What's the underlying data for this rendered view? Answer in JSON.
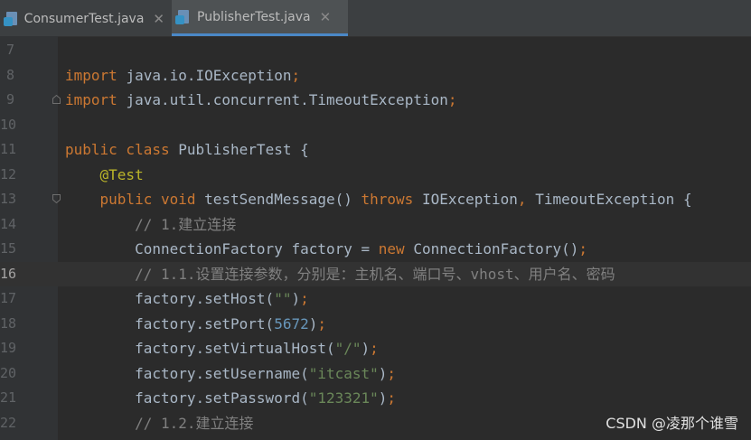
{
  "tabs": [
    {
      "label": "ConsumerTest.java",
      "active": false
    },
    {
      "label": "PublisherTest.java",
      "active": true
    }
  ],
  "editor": {
    "current_line": 16,
    "lines": [
      {
        "number": "7",
        "tokens": []
      },
      {
        "number": "8",
        "tokens": [
          [
            "kw",
            "import "
          ],
          [
            "plain",
            "java.io.IOException"
          ],
          [
            "kw",
            ";"
          ]
        ]
      },
      {
        "number": "9",
        "tokens": [
          [
            "kw",
            "import "
          ],
          [
            "plain",
            "java.util.concurrent.TimeoutException"
          ],
          [
            "kw",
            ";"
          ]
        ]
      },
      {
        "number": "10",
        "tokens": []
      },
      {
        "number": "11",
        "tokens": [
          [
            "kw",
            "public class "
          ],
          [
            "plain",
            "PublisherTest {"
          ]
        ]
      },
      {
        "number": "12",
        "tokens": [
          [
            "plain",
            "    "
          ],
          [
            "ann",
            "@Test"
          ]
        ]
      },
      {
        "number": "13",
        "tokens": [
          [
            "plain",
            "    "
          ],
          [
            "kw",
            "public void "
          ],
          [
            "plain",
            "testSendMessage() "
          ],
          [
            "kw",
            "throws "
          ],
          [
            "plain",
            "IOException"
          ],
          [
            "kw",
            ", "
          ],
          [
            "plain",
            "TimeoutException {"
          ]
        ]
      },
      {
        "number": "14",
        "tokens": [
          [
            "plain",
            "        "
          ],
          [
            "cmt",
            "// 1.建立连接"
          ]
        ]
      },
      {
        "number": "15",
        "tokens": [
          [
            "plain",
            "        ConnectionFactory factory = "
          ],
          [
            "kw",
            "new "
          ],
          [
            "plain",
            "ConnectionFactory()"
          ],
          [
            "kw",
            ";"
          ]
        ]
      },
      {
        "number": "16",
        "tokens": [
          [
            "plain",
            "        "
          ],
          [
            "cmt",
            "// 1.1.设置连接参数，分别是：主机名、端口号、vhost、用户名、密码"
          ]
        ]
      },
      {
        "number": "17",
        "tokens": [
          [
            "plain",
            "        factory.setHost("
          ],
          [
            "str",
            "\"\""
          ],
          [
            "plain",
            ")"
          ],
          [
            "kw",
            ";"
          ]
        ]
      },
      {
        "number": "18",
        "tokens": [
          [
            "plain",
            "        factory.setPort("
          ],
          [
            "num",
            "5672"
          ],
          [
            "plain",
            ")"
          ],
          [
            "kw",
            ";"
          ]
        ]
      },
      {
        "number": "19",
        "tokens": [
          [
            "plain",
            "        factory.setVirtualHost("
          ],
          [
            "str",
            "\"/\""
          ],
          [
            "plain",
            ")"
          ],
          [
            "kw",
            ";"
          ]
        ]
      },
      {
        "number": "20",
        "tokens": [
          [
            "plain",
            "        factory.setUsername("
          ],
          [
            "str",
            "\"itcast\""
          ],
          [
            "plain",
            ")"
          ],
          [
            "kw",
            ";"
          ]
        ]
      },
      {
        "number": "21",
        "tokens": [
          [
            "plain",
            "        factory.setPassword("
          ],
          [
            "str",
            "\"123321\""
          ],
          [
            "plain",
            ")"
          ],
          [
            "kw",
            ";"
          ]
        ]
      },
      {
        "number": "22",
        "tokens": [
          [
            "plain",
            "        "
          ],
          [
            "cmt",
            "// 1.2.建立连接"
          ]
        ]
      }
    ]
  },
  "watermark": "CSDN @凌那个谁雪"
}
